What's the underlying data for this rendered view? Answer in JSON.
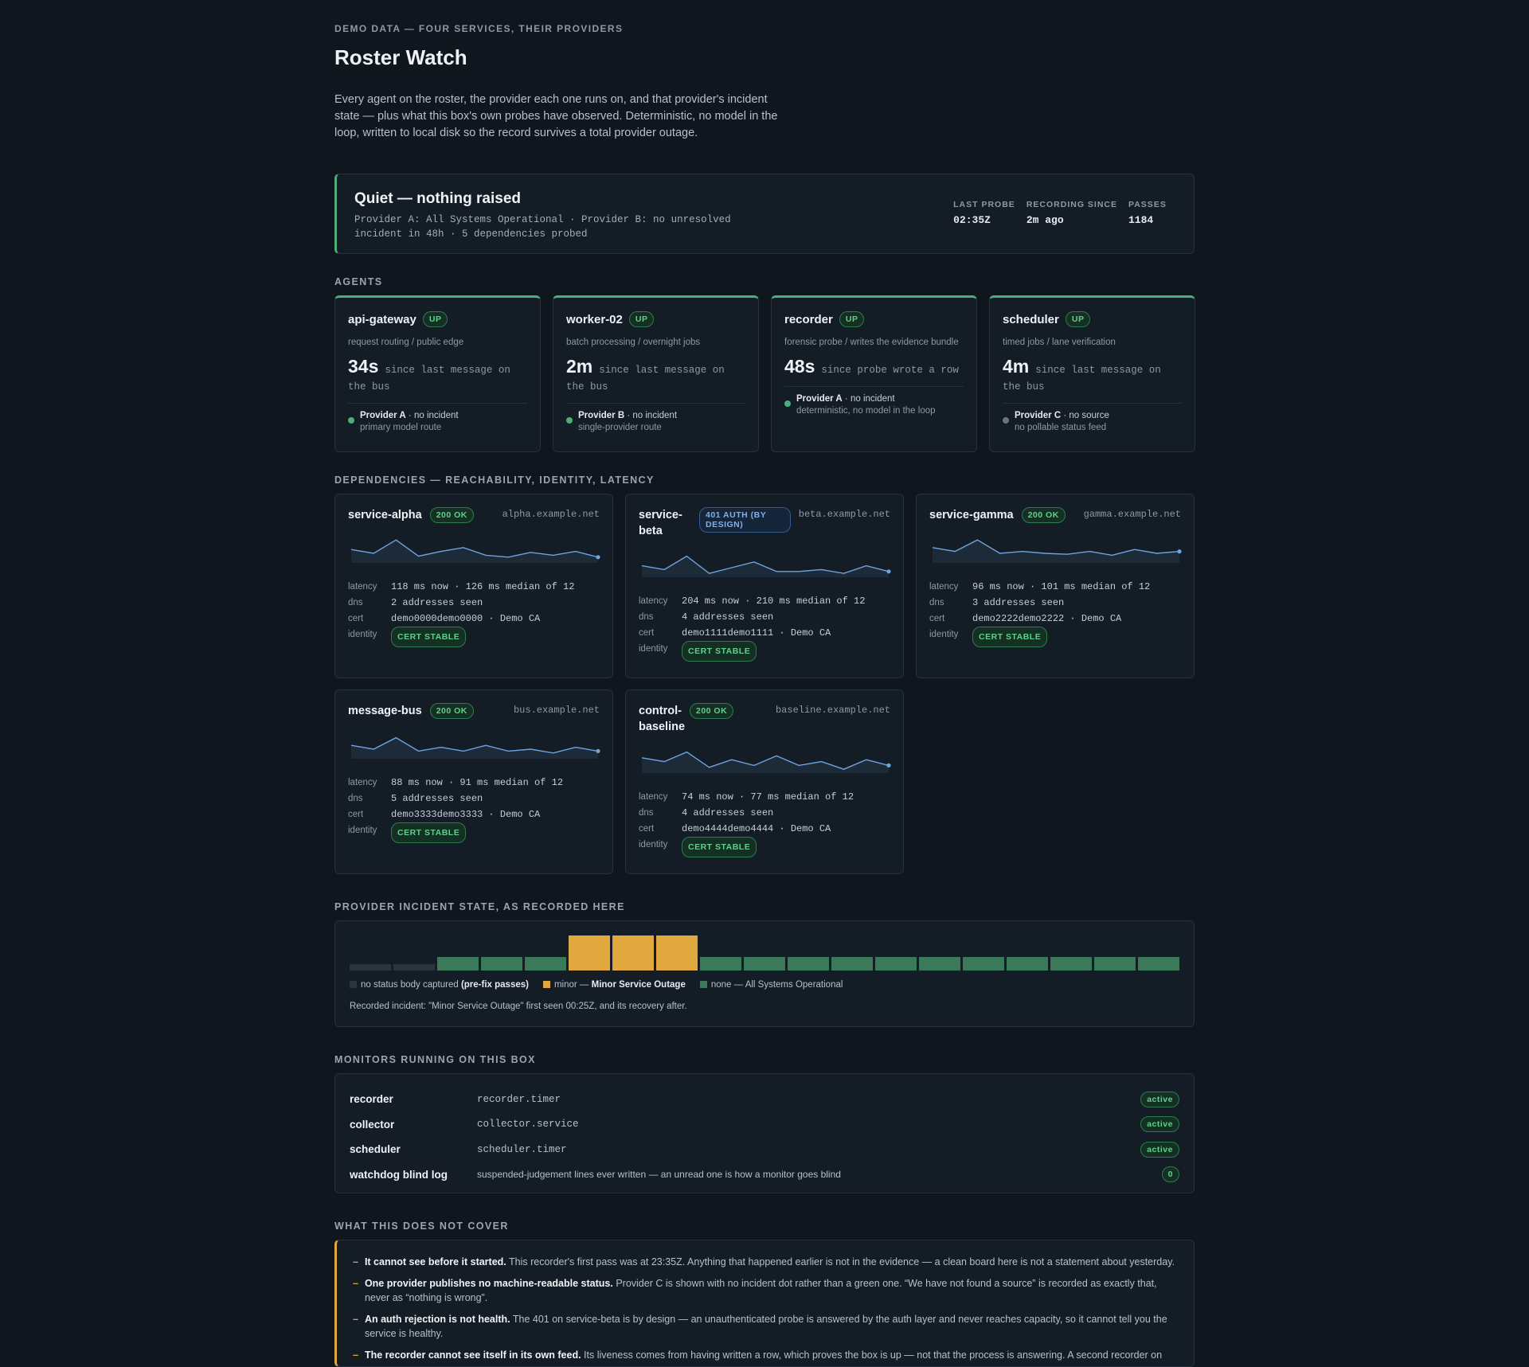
{
  "header": {
    "eyebrow": "DEMO DATA — FOUR SERVICES, THEIR PROVIDERS",
    "title": "Roster Watch",
    "intro": "Every agent on the roster, the provider each one runs on, and that provider's incident state — plus what this box's own probes have observed. Deterministic, no model in the loop, written to local disk so the record survives a total provider outage."
  },
  "banner": {
    "title": "Quiet — nothing raised",
    "sub": "Provider A: All Systems Operational · Provider B: no unresolved incident in 48h · 5 dependencies probed",
    "stats": [
      {
        "k": "LAST PROBE",
        "v": "02:35Z"
      },
      {
        "k": "RECORDING SINCE",
        "v": "2m ago"
      },
      {
        "k": "PASSES",
        "v": "1184"
      }
    ]
  },
  "sections": {
    "agents": "AGENTS",
    "deps": "DEPENDENCIES — REACHABILITY, IDENTITY, LATENCY",
    "incident": "PROVIDER INCIDENT STATE, AS RECORDED HERE",
    "monitors": "MONITORS RUNNING ON THIS BOX",
    "cover": "WHAT THIS DOES NOT COVER"
  },
  "agents": [
    {
      "name": "api-gateway",
      "status": "UP",
      "role": "request routing / public edge",
      "num": "34s",
      "txt": "since last message on the bus",
      "provider": "Provider A",
      "pstate": " · no incident",
      "pnote": "primary model route",
      "dot": "green"
    },
    {
      "name": "worker-02",
      "status": "UP",
      "role": "batch processing / overnight jobs",
      "num": "2m",
      "txt": "since last message on the bus",
      "provider": "Provider B",
      "pstate": " · no incident",
      "pnote": "single-provider route",
      "dot": "green"
    },
    {
      "name": "recorder",
      "status": "UP",
      "role": "forensic probe / writes the evidence bundle",
      "num": "48s",
      "txt": "since probe wrote a row",
      "provider": "Provider A",
      "pstate": " · no incident",
      "pnote": "deterministic, no model in the loop",
      "dot": "green"
    },
    {
      "name": "scheduler",
      "status": "UP",
      "role": "timed jobs / lane verification",
      "num": "4m",
      "txt": "since last message on the bus",
      "provider": "Provider C",
      "pstate": " · no source",
      "pnote": "no pollable status feed",
      "dot": "gray"
    }
  ],
  "deps": [
    {
      "name": "service-alpha",
      "badge": "200 OK",
      "kind": "green",
      "host": "alpha.example.net",
      "latency": "118 ms now · 126 ms median of 12",
      "dns": "2 addresses seen",
      "cert": "demo0000demo0000 · Demo CA",
      "identity": "CERT STABLE",
      "series": [
        14,
        10,
        24,
        7,
        12,
        16,
        8,
        6,
        11,
        8,
        12,
        6
      ]
    },
    {
      "name": "service-beta",
      "badge": "401 AUTH (BY DESIGN)",
      "kind": "blue",
      "host": "beta.example.net",
      "latency": "204 ms now · 210 ms median of 12",
      "dns": "4 addresses seen",
      "cert": "demo1111demo1111 · Demo CA",
      "identity": "CERT STABLE",
      "series": [
        12,
        8,
        22,
        4,
        10,
        16,
        6,
        6,
        8,
        4,
        12,
        6
      ]
    },
    {
      "name": "service-gamma",
      "badge": "200 OK",
      "kind": "green",
      "host": "gamma.example.net",
      "latency": "96 ms now · 101 ms median of 12",
      "dns": "3 addresses seen",
      "cert": "demo2222demo2222 · Demo CA",
      "identity": "CERT STABLE",
      "series": [
        16,
        12,
        24,
        10,
        12,
        10,
        9,
        12,
        8,
        14,
        10,
        12
      ]
    },
    {
      "name": "message-bus",
      "badge": "200 OK",
      "kind": "green",
      "host": "bus.example.net",
      "latency": "88 ms now · 91 ms median of 12",
      "dns": "5 addresses seen",
      "cert": "demo3333demo3333 · Demo CA",
      "identity": "CERT STABLE",
      "series": [
        14,
        10,
        22,
        8,
        12,
        8,
        14,
        8,
        10,
        6,
        12,
        8
      ]
    },
    {
      "name": "control-baseline",
      "badge": "200 OK",
      "kind": "green",
      "host": "baseline.example.net",
      "latency": "74 ms now · 77 ms median of 12",
      "dns": "4 addresses seen",
      "cert": "demo4444demo4444 · Demo CA",
      "identity": "CERT STABLE",
      "series": [
        16,
        12,
        22,
        6,
        14,
        8,
        18,
        8,
        12,
        4,
        14,
        8
      ]
    }
  ],
  "incident": {
    "bars": [
      "none_captured",
      "none_captured",
      "none",
      "none",
      "none",
      "minor",
      "minor",
      "minor",
      "none",
      "none",
      "none",
      "none",
      "none",
      "none",
      "none",
      "none",
      "none",
      "none",
      "none"
    ],
    "legend": [
      {
        "color": "#2a3541",
        "text": "no status body captured ",
        "bold": "(pre-fix passes)"
      },
      {
        "color": "#e0a83e",
        "text": "minor — ",
        "bold": "Minor Service Outage"
      },
      {
        "color": "#3a7a5a",
        "text": "none — All Systems Operational",
        "bold": ""
      }
    ],
    "note": "Recorded incident: \"Minor Service Outage\" first seen 00:25Z, and its recovery after."
  },
  "monitors": [
    {
      "name": "recorder",
      "unit": "recorder.timer",
      "status": "active",
      "sans": false
    },
    {
      "name": "collector",
      "unit": "collector.service",
      "status": "active",
      "sans": false
    },
    {
      "name": "scheduler",
      "unit": "scheduler.timer",
      "status": "active",
      "sans": false
    },
    {
      "name": "watchdog blind log",
      "unit": "suspended-judgement lines ever written — an unread one is how a monitor goes blind",
      "status": "0",
      "sans": true
    }
  ],
  "cover": [
    {
      "bold": "It cannot see before it started.",
      "text": " This recorder's first pass was at 23:35Z. Anything that happened earlier is not in the evidence — a clean board here is not a statement about yesterday."
    },
    {
      "bold": "One provider publishes no machine-readable status.",
      "text": " Provider C is shown with no incident dot rather than a green one. “We have not found a source” is recorded as exactly that, never as “nothing is wrong”."
    },
    {
      "bold": "An auth rejection is not health.",
      "text": " The 401 on service-beta is by design — an unauthenticated probe is answered by the auth layer and never reaches capacity, so it cannot tell you the service is healthy."
    },
    {
      "bold": "The recorder cannot see itself in its own feed.",
      "text": " Its liveness comes from having written a row, which proves the box is up — not that the process is answering. A second recorder on"
    }
  ],
  "colors": {
    "green": "#4caf7a",
    "amber": "#e0a83e",
    "blue": "#6fa3df"
  }
}
